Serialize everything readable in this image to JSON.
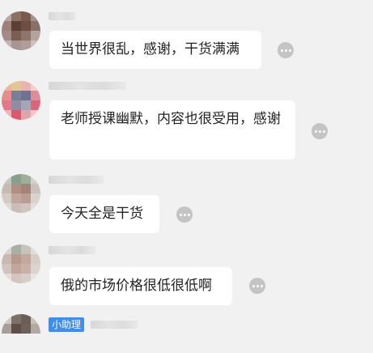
{
  "messages": [
    {
      "text": "当世界很乱，感谢，干货满满"
    },
    {
      "text": "老师授课幽默，内容也很受用，感谢"
    },
    {
      "text": "今天全是干货"
    },
    {
      "text": "俄的市场价格很低很低啊"
    }
  ],
  "last": {
    "badge": "小助理"
  },
  "colors": {
    "bubble": "#ffffff",
    "background": "#f1f1f1",
    "badge": "#3d8ef0"
  },
  "icons": {
    "more": "more-dots-icon"
  }
}
